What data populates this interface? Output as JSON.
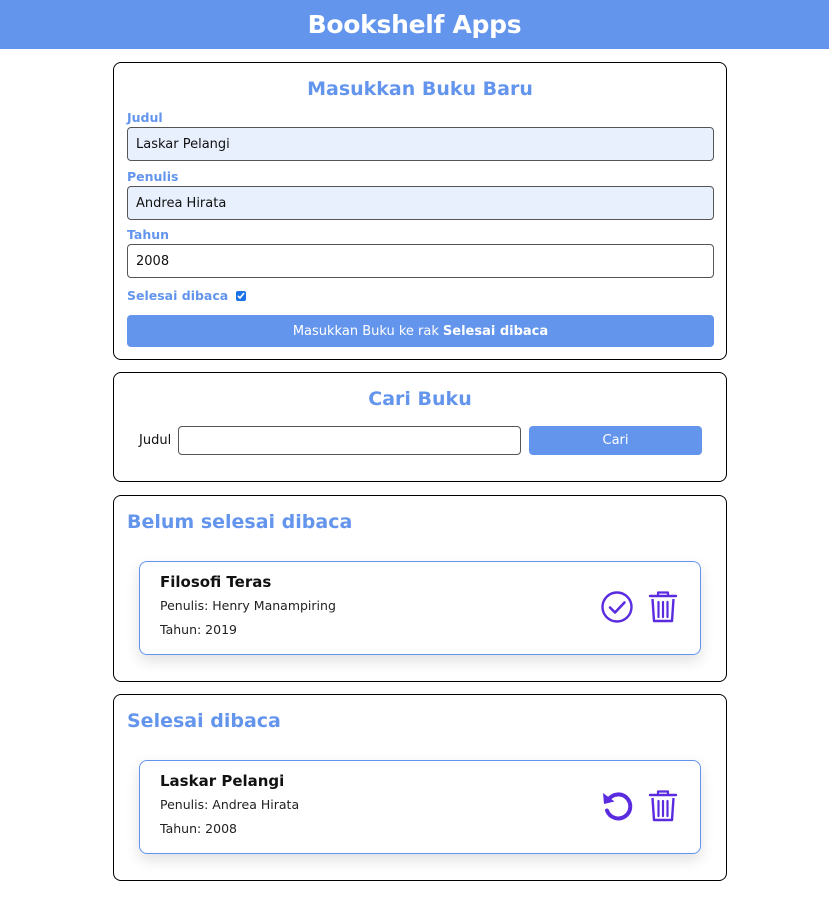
{
  "app": {
    "title": "Bookshelf Apps"
  },
  "input_section": {
    "title": "Masukkan Buku Baru",
    "title_label": "Judul",
    "title_value": "Laskar Pelangi",
    "author_label": "Penulis",
    "author_value": "Andrea Hirata",
    "year_label": "Tahun",
    "year_value": "2008",
    "complete_label": "Selesai dibaca",
    "complete_checked": true,
    "submit_prefix": "Masukkan Buku ke rak",
    "submit_shelf": "Selesai dibaca"
  },
  "search_section": {
    "title": "Cari Buku",
    "label": "Judul",
    "value": "",
    "button": "Cari"
  },
  "unread_shelf": {
    "title": "Belum selesai dibaca",
    "books": [
      {
        "title": "Filosofi Teras",
        "author": "Penulis: Henry Manampiring",
        "year": "Tahun: 2019",
        "action_icon": "check-circle-icon"
      }
    ]
  },
  "read_shelf": {
    "title": "Selesai dibaca",
    "books": [
      {
        "title": "Laskar Pelangi",
        "author": "Penulis: Andrea Hirata",
        "year": "Tahun: 2008",
        "action_icon": "undo-icon"
      }
    ]
  },
  "colors": {
    "accent": "#6495ed",
    "icon": "#5b2be0",
    "input_fill": "#e8f0fe"
  }
}
